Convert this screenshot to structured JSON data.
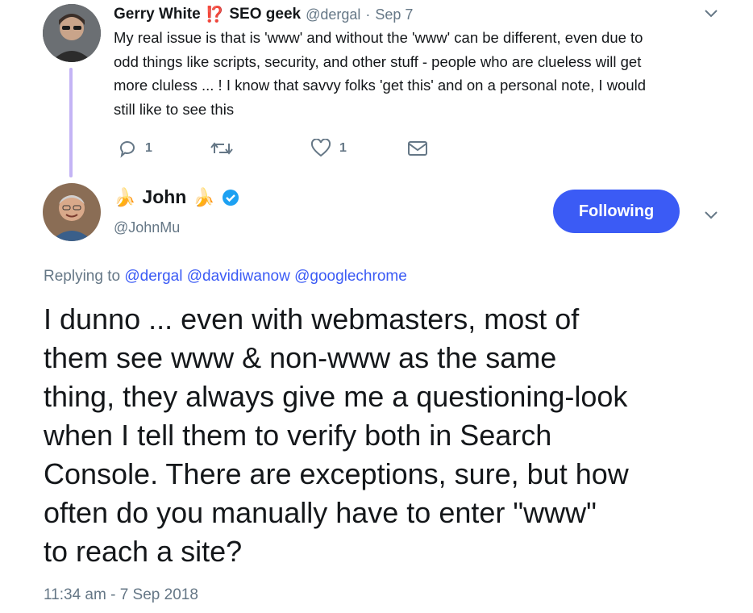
{
  "prev_tweet": {
    "name": "Gerry White",
    "emoji": "⁉️",
    "label": "SEO geek",
    "handle": "@dergal",
    "separator": "·",
    "date": "Sep 7",
    "lines": [
      "My real issue is that is 'www' and without the 'www' can be different, even due to",
      "odd things like scripts, security, and other stuff - people who are clueless will get",
      "more cluless ... ! I know that savvy folks 'get this' and on a personal note, I would",
      "still like to see this"
    ],
    "reply_count": "1",
    "like_count": "1"
  },
  "main_tweet": {
    "emoji": "🍌",
    "name": "John",
    "handle": "@JohnMu",
    "follow_label": "Following",
    "replying_prefix": "Replying to",
    "replying_to": [
      "@dergal",
      "@davidiwanow",
      "@googlechrome"
    ],
    "lines": [
      "I dunno ... even with webmasters, most of",
      "them see www & non-www as the same",
      "thing, they always give me a questioning-look",
      "when I tell them to verify both in Search",
      "Console. There are exceptions, sure, but how",
      "often do you manually have to enter \"www\"",
      "to reach a site?"
    ],
    "timestamp": "11:34 am - 7 Sep 2018"
  },
  "colors": {
    "accent": "#3b5bf5",
    "thread_line": "#c4b4f5",
    "muted": "#657786",
    "verified": "#1da1f2"
  }
}
